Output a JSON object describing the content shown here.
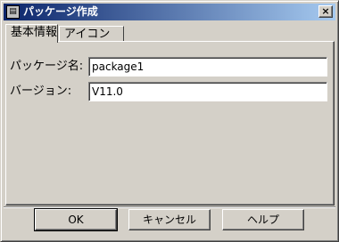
{
  "window": {
    "title": "パッケージ作成",
    "close_glyph": "×"
  },
  "tabs": [
    {
      "label": "基本情報"
    },
    {
      "label": "アイコン"
    }
  ],
  "form": {
    "package_name_label": "パッケージ名:",
    "package_name_value": "package1",
    "version_label": "バージョン:",
    "version_value": "V11.0"
  },
  "buttons": {
    "ok": "OK",
    "cancel": "キャンセル",
    "help": "ヘルプ"
  }
}
